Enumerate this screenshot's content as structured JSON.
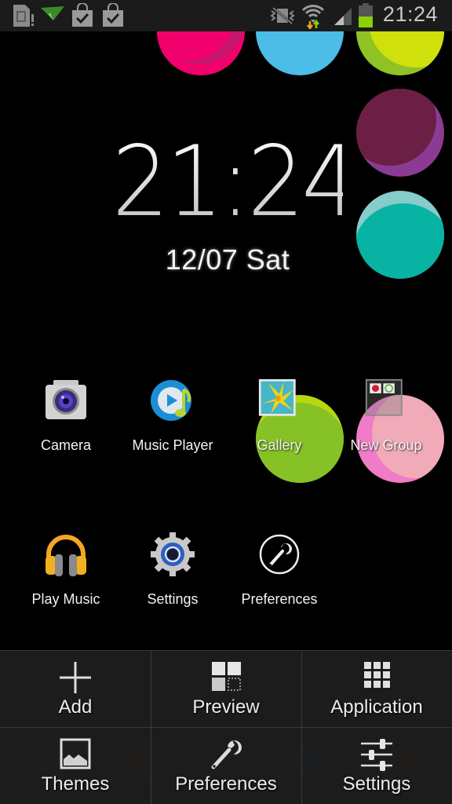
{
  "status_bar": {
    "time": "21:24",
    "left_icons": [
      "sim-card-icon",
      "paper-plane-icon",
      "shopping-bag-check-icon",
      "shopping-bag-check-icon"
    ],
    "right_icons": [
      "vibrate-mute-icon",
      "wifi-icon",
      "signal-icon",
      "battery-icon"
    ],
    "battery_level_fraction": 0.5,
    "colors": {
      "battery": "#8ccf0a",
      "wifi_up": "#8ccf0a",
      "wifi_down": "#f0a020"
    }
  },
  "clock_widget": {
    "time": "21:24",
    "date": "12/07 Sat"
  },
  "wallpaper": {
    "bubbles": [
      {
        "name": "pink",
        "color": "#f0006a",
        "accent": "#c8166e"
      },
      {
        "name": "blue",
        "color": "#4bbde6",
        "accent": "#4bbde6"
      },
      {
        "name": "lime",
        "color": "#cfe00c",
        "accent": "#8fc224"
      },
      {
        "name": "plum",
        "color": "#6c1f45",
        "accent": "#8c3b94"
      },
      {
        "name": "teal",
        "color": "#08b3a4",
        "accent": "#86cccb"
      },
      {
        "name": "green",
        "color": "#86c225",
        "accent": "#b7d70e"
      },
      {
        "name": "light-pink",
        "color": "#f0aab8",
        "accent": "#f07bc6"
      }
    ]
  },
  "apps": [
    {
      "label": "Camera",
      "icon": "camera-icon"
    },
    {
      "label": "Music Player",
      "icon": "music-player-icon"
    },
    {
      "label": "Gallery",
      "icon": "gallery-icon"
    },
    {
      "label": "New Group",
      "icon": "folder-group-icon"
    },
    {
      "label": "Play Music",
      "icon": "headphones-icon"
    },
    {
      "label": "Settings",
      "icon": "gear-icon"
    },
    {
      "label": "Preferences",
      "icon": "wrench-circle-icon"
    }
  ],
  "menu": {
    "items": [
      {
        "label": "Add",
        "icon": "plus-icon"
      },
      {
        "label": "Preview",
        "icon": "preview-grid-icon"
      },
      {
        "label": "Application",
        "icon": "app-grid-icon"
      },
      {
        "label": "Themes",
        "icon": "image-icon"
      },
      {
        "label": "Preferences",
        "icon": "wrench-icon"
      },
      {
        "label": "Settings",
        "icon": "sliders-icon"
      }
    ]
  }
}
